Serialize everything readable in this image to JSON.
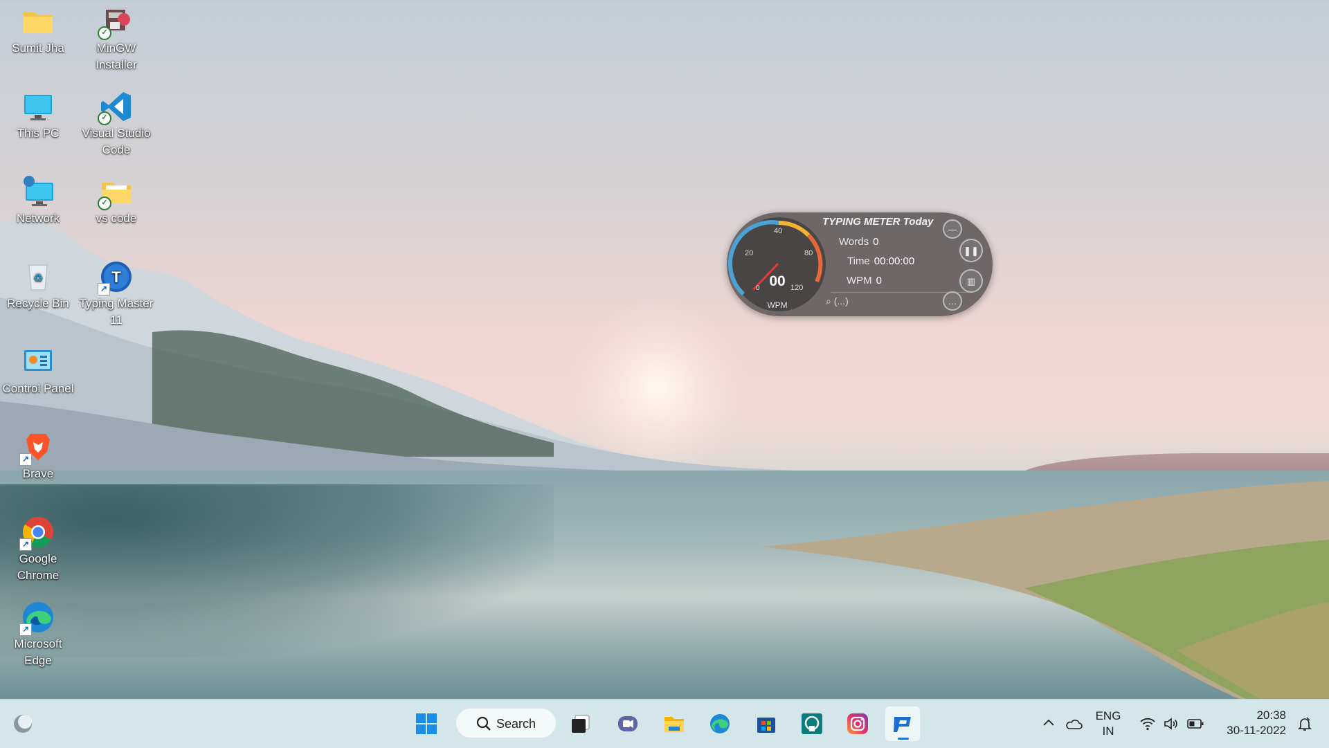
{
  "desktop": {
    "icons": [
      {
        "label": "Sumit Jha",
        "icon": "folder-icon"
      },
      {
        "label": "MinGW Installer",
        "icon": "mingw-installer-icon"
      },
      {
        "label": "This PC",
        "icon": "monitor-icon"
      },
      {
        "label": "Visual Studio Code",
        "icon": "vscode-icon"
      },
      {
        "label": "Network",
        "icon": "network-icon"
      },
      {
        "label": "vs code",
        "icon": "folder-icon"
      },
      {
        "label": "Recycle Bin",
        "icon": "recycle-bin-icon"
      },
      {
        "label": "Typing Master 11",
        "icon": "typing-master-icon"
      },
      {
        "label": "Control Panel",
        "icon": "control-panel-icon"
      },
      {
        "label": "Brave",
        "icon": "brave-icon"
      },
      {
        "label": "Google Chrome",
        "icon": "chrome-icon"
      },
      {
        "label": "Microsoft Edge",
        "icon": "edge-icon"
      }
    ]
  },
  "typing_meter": {
    "title": "TYPING METER Today",
    "gauge_value": "00",
    "gauge_unit": "WPM",
    "gauge_ticks": [
      "0",
      "20",
      "40",
      "80",
      "120"
    ],
    "words_label": "Words",
    "words_value": "0",
    "time_label": "Time",
    "time_value": "00:00:00",
    "wpm_label": "WPM",
    "wpm_value": "0",
    "search_text": "(...)",
    "buttons": [
      "minimize-icon",
      "pause-icon",
      "statistics-icon",
      "more-icon"
    ]
  },
  "taskbar": {
    "search_label": "Search",
    "apps": [
      "start-icon",
      "task-view-icon",
      "teams-chat-icon",
      "file-explorer-icon",
      "edge-icon",
      "microsoft-store-icon",
      "app-icon",
      "instagram-icon",
      "typing-master-icon"
    ],
    "tray": {
      "language_line1": "ENG",
      "language_line2": "IN",
      "time": "20:38",
      "date": "30-11-2022"
    }
  },
  "colors": {
    "taskbar_bg": "#d3e6ea",
    "accent": "#1e6fd9",
    "meter_bg": "#5f5858"
  }
}
